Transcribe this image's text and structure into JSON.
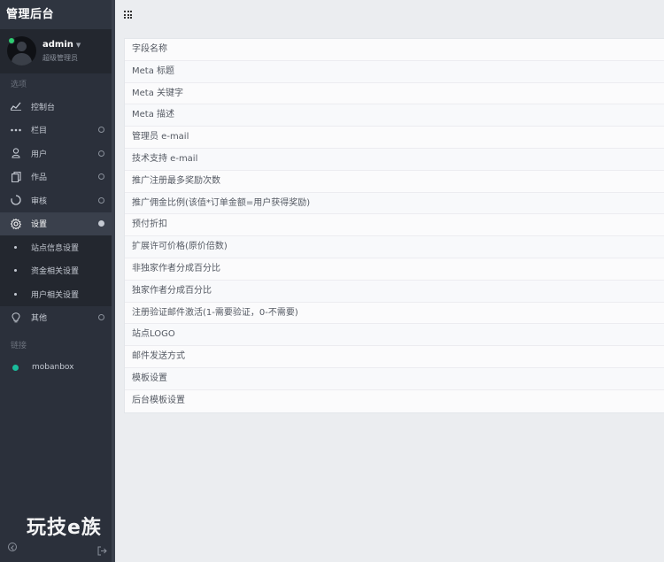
{
  "app": {
    "title": "管理后台"
  },
  "user": {
    "name": "admin",
    "role": "超级管理员"
  },
  "sidebar": {
    "section_options": "选项",
    "section_links": "链接",
    "items": [
      {
        "label": "控制台",
        "icon": "chart-line-icon"
      },
      {
        "label": "栏目",
        "icon": "dots-icon"
      },
      {
        "label": "用户",
        "icon": "user-icon"
      },
      {
        "label": "作品",
        "icon": "copy-icon"
      },
      {
        "label": "审核",
        "icon": "spinner-icon"
      },
      {
        "label": "设置",
        "icon": "gear-icon"
      },
      {
        "label": "其他",
        "icon": "bulb-icon"
      }
    ],
    "settings_sub": [
      "站点信息设置",
      "资金相关设置",
      "用户相关设置"
    ],
    "links": [
      {
        "label": "mobanbox",
        "color": "#1abc9c"
      }
    ]
  },
  "watermark": "玩技e族",
  "fields": [
    "字段名称",
    "Meta 标题",
    "Meta 关键字",
    "Meta 描述",
    "管理员 e-mail",
    "技术支持 e-mail",
    "推广注册最多奖励次数",
    "推广佣金比例(该值*订单金额=用户获得奖励)",
    "预付折扣",
    "扩展许可价格(原价倍数)",
    "非独家作者分成百分比",
    "独家作者分成百分比",
    "注册验证邮件激活(1-需要验证，0-不需要)",
    "站点LOGO",
    "邮件发送方式",
    "模板设置",
    "后台模板设置"
  ],
  "colors": {
    "sidebar_bg": "#2b303b",
    "online": "#2ecc71",
    "link_dot": "#1abc9c",
    "content_bg": "#ebedf0"
  }
}
